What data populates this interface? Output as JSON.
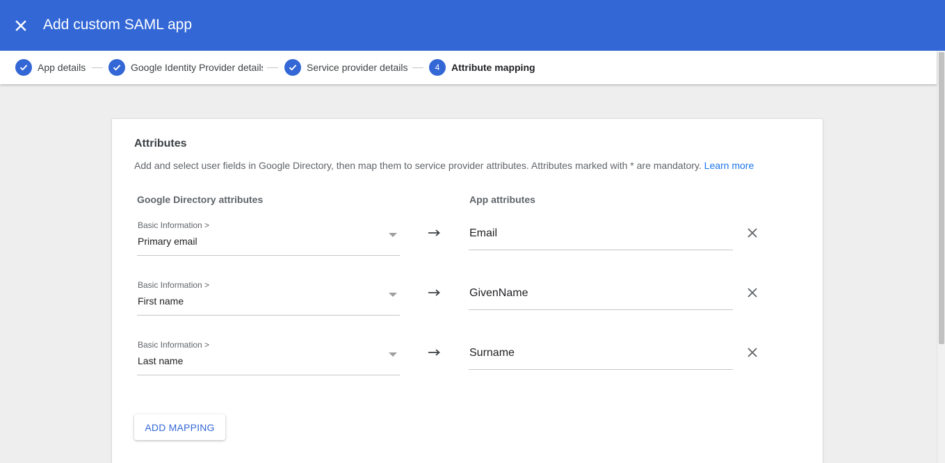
{
  "header": {
    "title": "Add custom SAML app",
    "close_icon": "close-icon",
    "background": "#3367d6"
  },
  "stepper": {
    "steps": [
      {
        "label": "App details",
        "state": "completed",
        "icon": "check-icon"
      },
      {
        "label": "Google Identity Provider details",
        "state": "completed",
        "icon": "check-icon"
      },
      {
        "label": "Service provider details",
        "state": "completed",
        "icon": "check-icon"
      },
      {
        "label": "Attribute mapping",
        "state": "active",
        "number": "4"
      }
    ]
  },
  "attributes": {
    "title": "Attributes",
    "description": "Add and select user fields in Google Directory, then map them to service provider attributes. Attributes marked with * are mandatory.",
    "learn_more": "Learn more",
    "directory_header": "Google Directory attributes",
    "app_header": "App attributes",
    "mappings": [
      {
        "category": "Basic Information >",
        "field": "Primary email",
        "app_attribute": "Email"
      },
      {
        "category": "Basic Information >",
        "field": "First name",
        "app_attribute": "GivenName"
      },
      {
        "category": "Basic Information >",
        "field": "Last name",
        "app_attribute": "Surname"
      }
    ],
    "add_mapping": "ADD MAPPING"
  },
  "colors": {
    "accent": "#3367d6",
    "link": "#1a73e8",
    "page_background": "#eeeeee"
  }
}
